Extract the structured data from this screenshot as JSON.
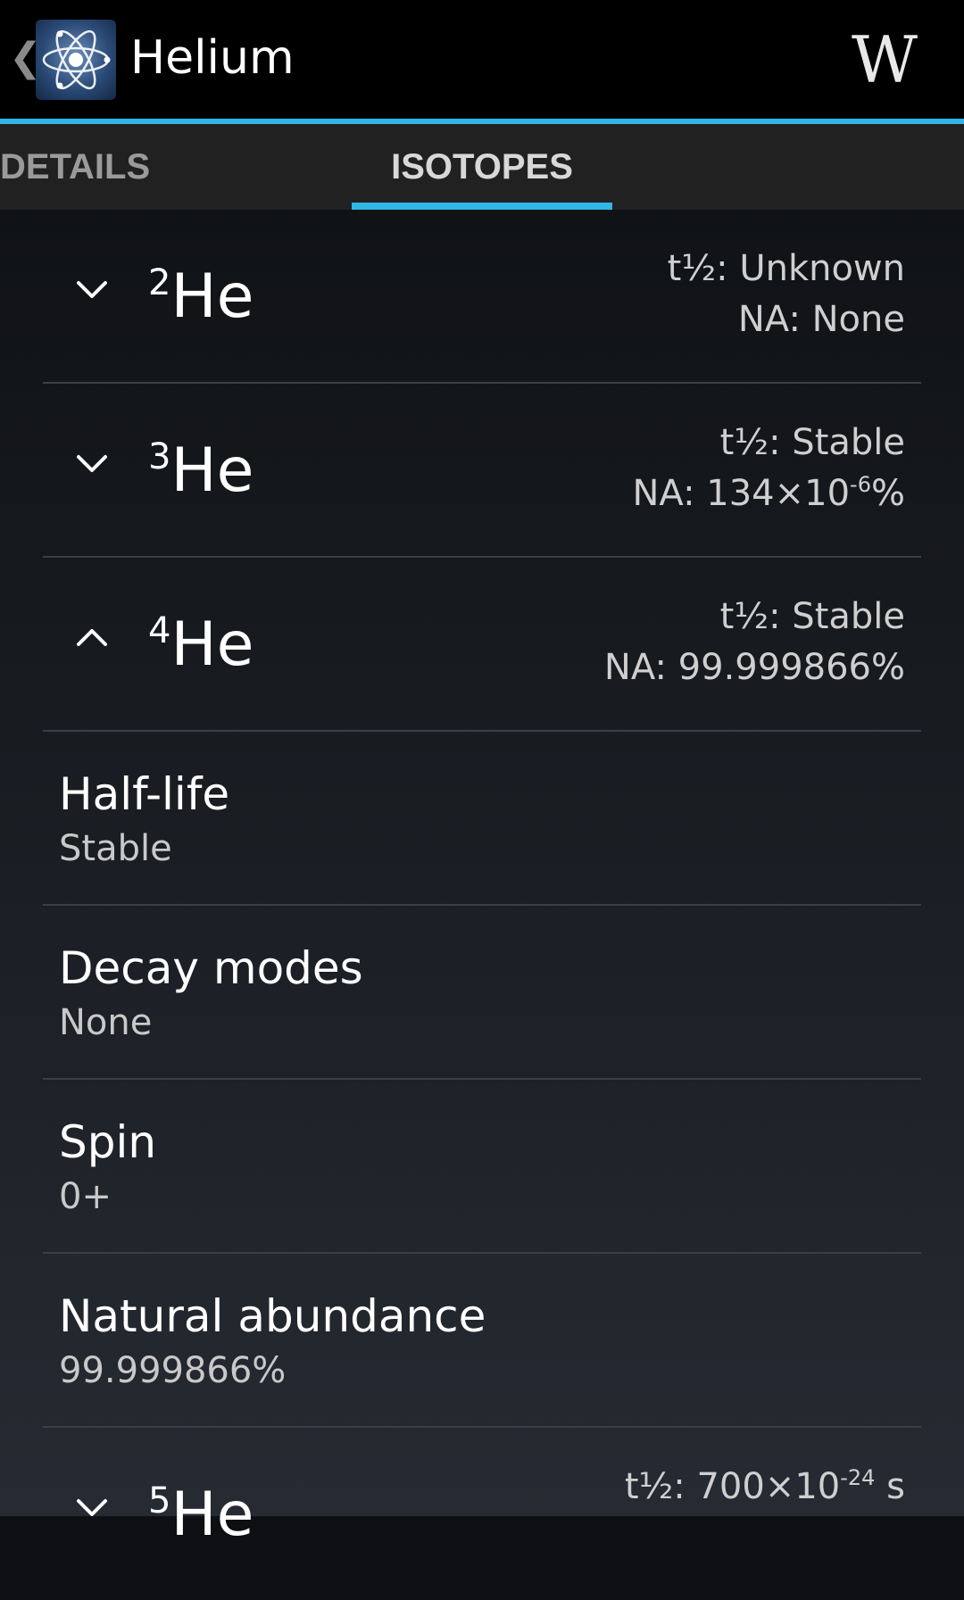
{
  "header": {
    "title": "Helium",
    "wiki_glyph": "W",
    "back_glyph": "❮",
    "app_icon": "atom-icon",
    "accent_color": "#33b5e5"
  },
  "tabs": [
    {
      "label": "DETAILS",
      "selected": false
    },
    {
      "label": "ISOTOPES",
      "selected": true
    }
  ],
  "isotopes": [
    {
      "mass": "2",
      "symbol": "He",
      "expanded": false,
      "halflife_line": "t½: Unknown",
      "na_line": "NA: None"
    },
    {
      "mass": "3",
      "symbol": "He",
      "expanded": false,
      "halflife_line": "t½: Stable",
      "na_prefix": "NA: 134×10",
      "na_exp": "-6",
      "na_suffix": "%"
    },
    {
      "mass": "4",
      "symbol": "He",
      "expanded": true,
      "halflife_line": "t½: Stable",
      "na_line": "NA: 99.999866%"
    },
    {
      "mass": "5",
      "symbol": "He",
      "expanded": false,
      "halflife_prefix": "t½: 700×10",
      "halflife_exp": "-24",
      "halflife_suffix": " s"
    }
  ],
  "properties": [
    {
      "label": "Half-life",
      "value": "Stable"
    },
    {
      "label": "Decay modes",
      "value": "None"
    },
    {
      "label": "Spin",
      "value": "0+"
    },
    {
      "label": "Natural abundance",
      "value": "99.999866%"
    }
  ]
}
